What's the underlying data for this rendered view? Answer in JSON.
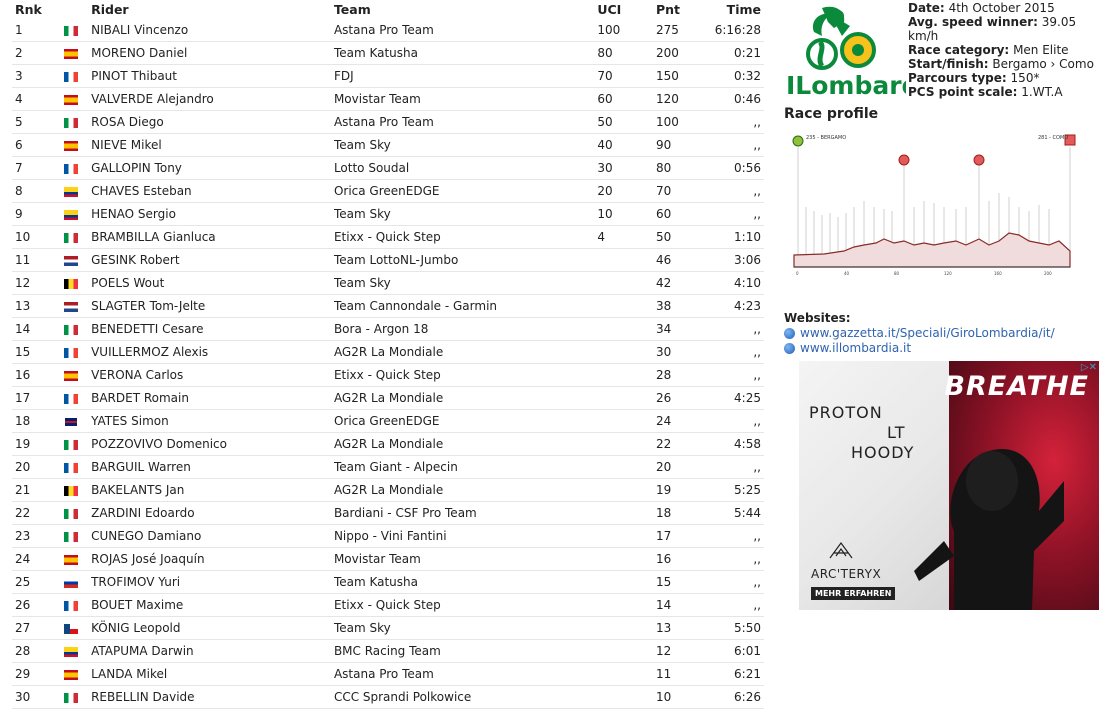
{
  "table": {
    "headers": {
      "rnk": "Rnk",
      "rider": "Rider",
      "team": "Team",
      "uci": "UCI",
      "pnt": "Pnt",
      "time": "Time"
    },
    "rows": [
      {
        "rnk": "1",
        "flag": "it",
        "rider": "NIBALI Vincenzo",
        "team": "Astana Pro Team",
        "uci": "100",
        "pnt": "275",
        "time": "6:16:28"
      },
      {
        "rnk": "2",
        "flag": "es",
        "rider": "MORENO Daniel",
        "team": "Team Katusha",
        "uci": "80",
        "pnt": "200",
        "time": "0:21"
      },
      {
        "rnk": "3",
        "flag": "fr",
        "rider": "PINOT Thibaut",
        "team": "FDJ",
        "uci": "70",
        "pnt": "150",
        "time": "0:32"
      },
      {
        "rnk": "4",
        "flag": "es",
        "rider": "VALVERDE Alejandro",
        "team": "Movistar Team",
        "uci": "60",
        "pnt": "120",
        "time": "0:46"
      },
      {
        "rnk": "5",
        "flag": "it",
        "rider": "ROSA Diego",
        "team": "Astana Pro Team",
        "uci": "50",
        "pnt": "100",
        "time": ",,"
      },
      {
        "rnk": "6",
        "flag": "es",
        "rider": "NIEVE Mikel",
        "team": "Team Sky",
        "uci": "40",
        "pnt": "90",
        "time": ",,"
      },
      {
        "rnk": "7",
        "flag": "fr",
        "rider": "GALLOPIN Tony",
        "team": "Lotto Soudal",
        "uci": "30",
        "pnt": "80",
        "time": "0:56"
      },
      {
        "rnk": "8",
        "flag": "co",
        "rider": "CHAVES Esteban",
        "team": "Orica GreenEDGE",
        "uci": "20",
        "pnt": "70",
        "time": ",,"
      },
      {
        "rnk": "9",
        "flag": "co",
        "rider": "HENAO Sergio",
        "team": "Team Sky",
        "uci": "10",
        "pnt": "60",
        "time": ",,"
      },
      {
        "rnk": "10",
        "flag": "it",
        "rider": "BRAMBILLA Gianluca",
        "team": "Etixx - Quick Step",
        "uci": "4",
        "pnt": "50",
        "time": "1:10"
      },
      {
        "rnk": "11",
        "flag": "nl",
        "rider": "GESINK Robert",
        "team": "Team LottoNL-Jumbo",
        "uci": "",
        "pnt": "46",
        "time": "3:06"
      },
      {
        "rnk": "12",
        "flag": "be",
        "rider": "POELS Wout",
        "team": "Team Sky",
        "uci": "",
        "pnt": "42",
        "time": "4:10"
      },
      {
        "rnk": "13",
        "flag": "nl",
        "rider": "SLAGTER Tom-Jelte",
        "team": "Team Cannondale - Garmin",
        "uci": "",
        "pnt": "38",
        "time": "4:23"
      },
      {
        "rnk": "14",
        "flag": "it",
        "rider": "BENEDETTI Cesare",
        "team": "Bora - Argon 18",
        "uci": "",
        "pnt": "34",
        "time": ",,"
      },
      {
        "rnk": "15",
        "flag": "fr",
        "rider": "VUILLERMOZ Alexis",
        "team": "AG2R La Mondiale",
        "uci": "",
        "pnt": "30",
        "time": ",,"
      },
      {
        "rnk": "16",
        "flag": "es",
        "rider": "VERONA Carlos",
        "team": "Etixx - Quick Step",
        "uci": "",
        "pnt": "28",
        "time": ",,"
      },
      {
        "rnk": "17",
        "flag": "fr",
        "rider": "BARDET Romain",
        "team": "AG2R La Mondiale",
        "uci": "",
        "pnt": "26",
        "time": "4:25"
      },
      {
        "rnk": "18",
        "flag": "gb",
        "rider": "YATES Simon",
        "team": "Orica GreenEDGE",
        "uci": "",
        "pnt": "24",
        "time": ",,"
      },
      {
        "rnk": "19",
        "flag": "it",
        "rider": "POZZOVIVO Domenico",
        "team": "AG2R La Mondiale",
        "uci": "",
        "pnt": "22",
        "time": "4:58"
      },
      {
        "rnk": "20",
        "flag": "fr",
        "rider": "BARGUIL Warren",
        "team": "Team Giant - Alpecin",
        "uci": "",
        "pnt": "20",
        "time": ",,"
      },
      {
        "rnk": "21",
        "flag": "be",
        "rider": "BAKELANTS Jan",
        "team": "AG2R La Mondiale",
        "uci": "",
        "pnt": "19",
        "time": "5:25"
      },
      {
        "rnk": "22",
        "flag": "it",
        "rider": "ZARDINI Edoardo",
        "team": "Bardiani - CSF Pro Team",
        "uci": "",
        "pnt": "18",
        "time": "5:44"
      },
      {
        "rnk": "23",
        "flag": "it",
        "rider": "CUNEGO Damiano",
        "team": "Nippo - Vini Fantini",
        "uci": "",
        "pnt": "17",
        "time": ",,"
      },
      {
        "rnk": "24",
        "flag": "es",
        "rider": "ROJAS José Joaquín",
        "team": "Movistar Team",
        "uci": "",
        "pnt": "16",
        "time": ",,"
      },
      {
        "rnk": "25",
        "flag": "ru",
        "rider": "TROFIMOV Yuri",
        "team": "Team Katusha",
        "uci": "",
        "pnt": "15",
        "time": ",,"
      },
      {
        "rnk": "26",
        "flag": "fr",
        "rider": "BOUET Maxime",
        "team": "Etixx - Quick Step",
        "uci": "",
        "pnt": "14",
        "time": ",,"
      },
      {
        "rnk": "27",
        "flag": "cz",
        "rider": "KÖNIG Leopold",
        "team": "Team Sky",
        "uci": "",
        "pnt": "13",
        "time": "5:50"
      },
      {
        "rnk": "28",
        "flag": "co",
        "rider": "ATAPUMA Darwin",
        "team": "BMC Racing Team",
        "uci": "",
        "pnt": "12",
        "time": "6:01"
      },
      {
        "rnk": "29",
        "flag": "es",
        "rider": "LANDA Mikel",
        "team": "Astana Pro Team",
        "uci": "",
        "pnt": "11",
        "time": "6:21"
      },
      {
        "rnk": "30",
        "flag": "it",
        "rider": "REBELLIN Davide",
        "team": "CCC Sprandi Polkowice",
        "uci": "",
        "pnt": "10",
        "time": "6:26"
      }
    ]
  },
  "flag_colors": {
    "it": [
      "#009246",
      "#ffffff",
      "#ce2b37"
    ],
    "fr": [
      "#0055a4",
      "#ffffff",
      "#ef4135"
    ],
    "es": [
      "#c60b1e",
      "#ffc400",
      "#c60b1e"
    ],
    "co": [
      "#fcd116",
      "#003893",
      "#ce1126"
    ],
    "nl": [
      "#ae1c28",
      "#ffffff",
      "#21468b"
    ],
    "be": [
      "#000000",
      "#fdda24",
      "#ef3340"
    ],
    "ru": [
      "#ffffff",
      "#0039a6",
      "#d52b1e"
    ],
    "gb": [
      "#012169",
      "#ffffff",
      "#c8102e"
    ],
    "cz": [
      "#ffffff",
      "#d7141a",
      "#11457e"
    ]
  },
  "logo": {
    "wordmark": "ILombardia"
  },
  "race_info": [
    {
      "label": "Date:",
      "value": "4th October 2015"
    },
    {
      "label": "Avg. speed winner:",
      "value": "39.05 km/h"
    },
    {
      "label": "Race category:",
      "value": "Men Elite"
    },
    {
      "label": "Start/finish:",
      "value": "Bergamo › Como"
    },
    {
      "label": "Parcours type:",
      "value": "150*"
    },
    {
      "label": "PCS point scale:",
      "value": "1.WT.A"
    }
  ],
  "profile": {
    "title": "Race profile",
    "start_label": "235 - BERGAMO",
    "finish_label": "281 - COMO"
  },
  "websites": {
    "title": "Websites:",
    "links": [
      "www.gazzetta.it/Speciali/GiroLombardia/it/",
      "www.illombardia.it"
    ]
  },
  "ad": {
    "headline": "BREATHE",
    "product_line1": "PROTON",
    "product_line2": "LT",
    "product_line3": "HOODY",
    "brand": "ARC'TERYX",
    "cta": "MEHR ERFAHREN",
    "adchoice": "▷✕"
  }
}
